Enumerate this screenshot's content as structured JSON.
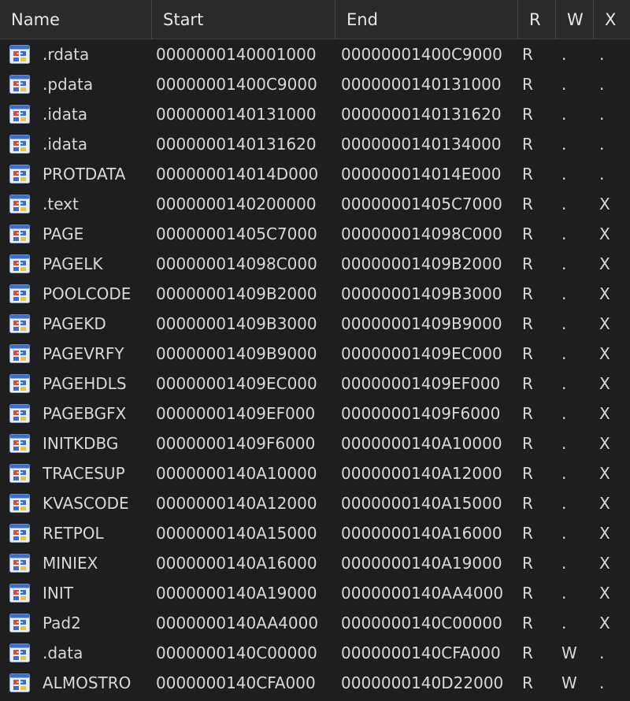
{
  "headers": {
    "name": "Name",
    "start": "Start",
    "end": "End",
    "r": "R",
    "w": "W",
    "x": "X"
  },
  "icon": "segment-icon",
  "rows": [
    {
      "name": ".rdata",
      "start": "0000000140001000",
      "end": "00000001400C9000",
      "r": "R",
      "w": ".",
      "x": "."
    },
    {
      "name": ".pdata",
      "start": "00000001400C9000",
      "end": "0000000140131000",
      "r": "R",
      "w": ".",
      "x": "."
    },
    {
      "name": ".idata",
      "start": "0000000140131000",
      "end": "0000000140131620",
      "r": "R",
      "w": ".",
      "x": "."
    },
    {
      "name": ".idata",
      "start": "0000000140131620",
      "end": "0000000140134000",
      "r": "R",
      "w": ".",
      "x": "."
    },
    {
      "name": "PROTDATA",
      "start": "000000014014D000",
      "end": "000000014014E000",
      "r": "R",
      "w": ".",
      "x": "."
    },
    {
      "name": ".text",
      "start": "0000000140200000",
      "end": "00000001405C7000",
      "r": "R",
      "w": ".",
      "x": "X"
    },
    {
      "name": "PAGE",
      "start": "00000001405C7000",
      "end": "000000014098C000",
      "r": "R",
      "w": ".",
      "x": "X"
    },
    {
      "name": "PAGELK",
      "start": "000000014098C000",
      "end": "00000001409B2000",
      "r": "R",
      "w": ".",
      "x": "X"
    },
    {
      "name": "POOLCODE",
      "start": "00000001409B2000",
      "end": "00000001409B3000",
      "r": "R",
      "w": ".",
      "x": "X"
    },
    {
      "name": "PAGEKD",
      "start": "00000001409B3000",
      "end": "00000001409B9000",
      "r": "R",
      "w": ".",
      "x": "X"
    },
    {
      "name": "PAGEVRFY",
      "start": "00000001409B9000",
      "end": "00000001409EC000",
      "r": "R",
      "w": ".",
      "x": "X"
    },
    {
      "name": "PAGEHDLS",
      "start": "00000001409EC000",
      "end": "00000001409EF000",
      "r": "R",
      "w": ".",
      "x": "X"
    },
    {
      "name": "PAGEBGFX",
      "start": "00000001409EF000",
      "end": "00000001409F6000",
      "r": "R",
      "w": ".",
      "x": "X"
    },
    {
      "name": "INITKDBG",
      "start": "00000001409F6000",
      "end": "0000000140A10000",
      "r": "R",
      "w": ".",
      "x": "X"
    },
    {
      "name": "TRACESUP",
      "start": "0000000140A10000",
      "end": "0000000140A12000",
      "r": "R",
      "w": ".",
      "x": "X"
    },
    {
      "name": "KVASCODE",
      "start": "0000000140A12000",
      "end": "0000000140A15000",
      "r": "R",
      "w": ".",
      "x": "X"
    },
    {
      "name": "RETPOL",
      "start": "0000000140A15000",
      "end": "0000000140A16000",
      "r": "R",
      "w": ".",
      "x": "X"
    },
    {
      "name": "MINIEX",
      "start": "0000000140A16000",
      "end": "0000000140A19000",
      "r": "R",
      "w": ".",
      "x": "X"
    },
    {
      "name": "INIT",
      "start": "0000000140A19000",
      "end": "0000000140AA4000",
      "r": "R",
      "w": ".",
      "x": "X"
    },
    {
      "name": "Pad2",
      "start": "0000000140AA4000",
      "end": "0000000140C00000",
      "r": "R",
      "w": ".",
      "x": "X"
    },
    {
      "name": ".data",
      "start": "0000000140C00000",
      "end": "0000000140CFA000",
      "r": "R",
      "w": "W",
      "x": "."
    },
    {
      "name": "ALMOSTRO",
      "start": "0000000140CFA000",
      "end": "0000000140D22000",
      "r": "R",
      "w": "W",
      "x": "."
    }
  ],
  "colors": {
    "background": "#1e1e1e",
    "header_background": "#2a2a2a",
    "text": "#d8d8d8",
    "icon_blue": "#3a6fd0",
    "icon_red": "#d84a3a",
    "icon_yellow": "#f0c23a"
  }
}
